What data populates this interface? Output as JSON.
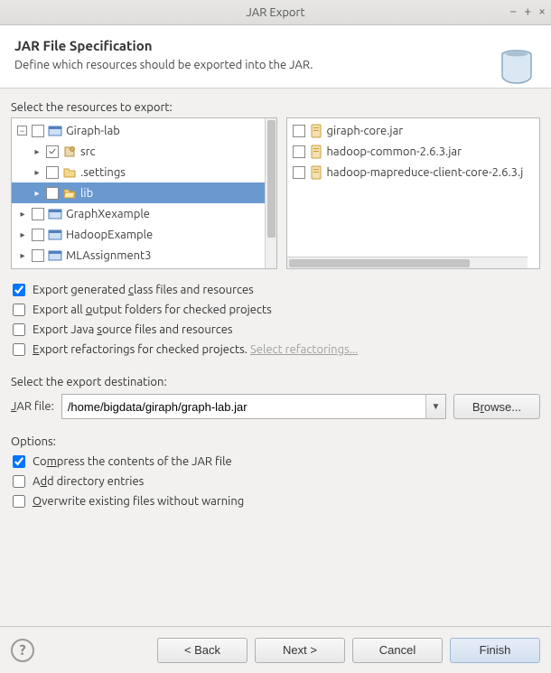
{
  "window": {
    "title": "JAR Export"
  },
  "header": {
    "title": "JAR File Specification",
    "subtitle": "Define which resources should be exported into the JAR."
  },
  "leftTreeLabel": "Select the resources to export:",
  "leftTree": {
    "root": "Giraph-lab",
    "children": [
      {
        "name": "src",
        "checked": true,
        "icon": "package"
      },
      {
        "name": ".settings",
        "checked": false,
        "icon": "folder"
      },
      {
        "name": "lib",
        "checked": false,
        "icon": "folder-open",
        "selected": true
      },
      {
        "name": "GraphXexample",
        "checked": false,
        "icon": "project",
        "isProject": true
      },
      {
        "name": "HadoopExample",
        "checked": false,
        "icon": "project",
        "isProject": true
      },
      {
        "name": "MLAssignment3",
        "checked": false,
        "icon": "project",
        "isProject": true
      }
    ]
  },
  "rightList": [
    {
      "name": "giraph-core.jar",
      "checked": false
    },
    {
      "name": "hadoop-common-2.6.3.jar",
      "checked": false
    },
    {
      "name": "hadoop-mapreduce-client-core-2.6.3.j",
      "checked": false
    }
  ],
  "exportOptions": {
    "generated": {
      "label": "Export generated class files and resources",
      "checked": true
    },
    "outputFolders": {
      "label": "Export all output folders for checked projects",
      "checked": false
    },
    "javaSource": {
      "label": "Export Java source files and resources",
      "checked": false
    },
    "refactorings": {
      "label": "Export refactorings for checked projects.",
      "checked": false,
      "link": "Select refactorings..."
    }
  },
  "destinationLabel": "Select the export destination:",
  "jarFile": {
    "label": "JAR file:",
    "value": "/home/bigdata/giraph/graph-lab.jar",
    "browse": "Browse..."
  },
  "optionsLabel": "Options:",
  "options": {
    "compress": {
      "label": "Compress the contents of the JAR file",
      "checked": true
    },
    "addDir": {
      "label": "Add directory entries",
      "checked": false
    },
    "overwrite": {
      "label": "Overwrite existing files without warning",
      "checked": false
    }
  },
  "buttons": {
    "back": "< Back",
    "next": "Next >",
    "cancel": "Cancel",
    "finish": "Finish"
  }
}
